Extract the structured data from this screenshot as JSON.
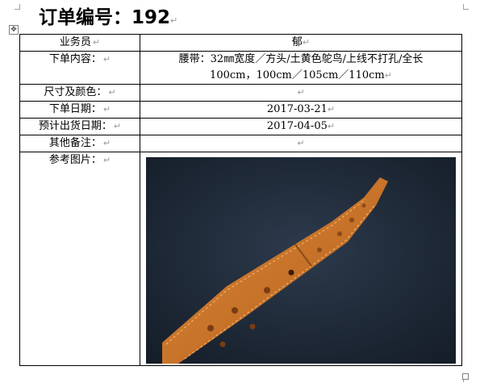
{
  "document": {
    "title": "订单编号：192",
    "paragraph_mark": "↵"
  },
  "table": {
    "rows": [
      {
        "label": "业务员",
        "value": "郁"
      },
      {
        "label": "下单内容：",
        "value_line1": "腰带：32㎜宽度／方头/土黄色鸵鸟/上线不打孔/全长",
        "value_line2": "100cm，100cm／105cm／110cm"
      },
      {
        "label": "尺寸及颜色：",
        "value": ""
      },
      {
        "label": "下单日期：",
        "value": "2017-03-21"
      },
      {
        "label": "预计出货日期：",
        "value": "2017-04-05"
      },
      {
        "label": "其他备注：",
        "value": ""
      },
      {
        "label": "参考图片：",
        "value": ""
      }
    ]
  },
  "image": {
    "description_icon": "belt-photo",
    "colors": {
      "background": "#1e2a3a",
      "leather": "#c8742a"
    }
  }
}
